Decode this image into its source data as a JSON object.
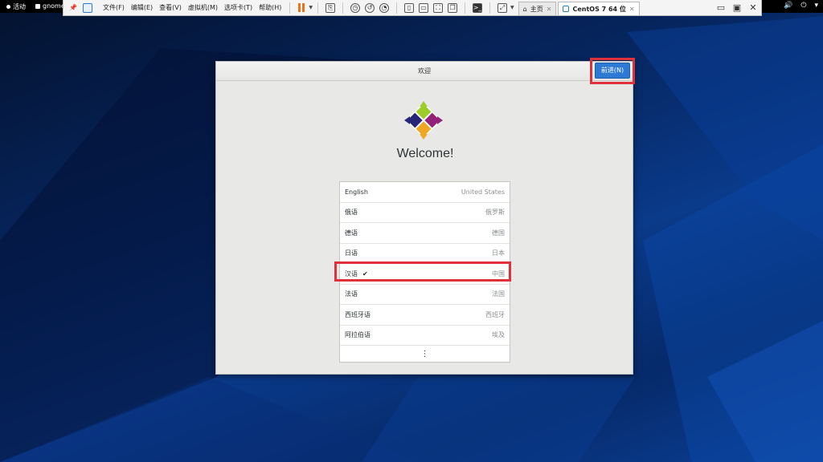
{
  "gnome_bar": {
    "activities": "活动",
    "app_menu": "gnome"
  },
  "vm_toolbar": {
    "menus": [
      "文件(F)",
      "编辑(E)",
      "查看(V)",
      "虚拟机(M)",
      "选项卡(T)",
      "帮助(H)"
    ],
    "tabs": [
      {
        "label": "主页",
        "active": false
      },
      {
        "label": "CentOS 7 64 位",
        "active": true
      }
    ]
  },
  "dialog": {
    "title": "欢迎",
    "next_button": "前进(N)",
    "welcome_heading": "Welcome!",
    "languages": [
      {
        "native": "English",
        "region": "United States",
        "selected": false
      },
      {
        "native": "俄语",
        "region": "俄罗斯",
        "selected": false
      },
      {
        "native": "德语",
        "region": "德国",
        "selected": false
      },
      {
        "native": "日语",
        "region": "日本",
        "selected": false
      },
      {
        "native": "汉语",
        "region": "中国",
        "selected": true
      },
      {
        "native": "法语",
        "region": "法国",
        "selected": false
      },
      {
        "native": "西班牙语",
        "region": "西班牙",
        "selected": false
      },
      {
        "native": "阿拉伯语",
        "region": "埃及",
        "selected": false
      }
    ],
    "more_symbol": "⋮",
    "check_symbol": "✔"
  },
  "colors": {
    "accent": "#2d7ad4",
    "highlight": "#e0303a"
  }
}
